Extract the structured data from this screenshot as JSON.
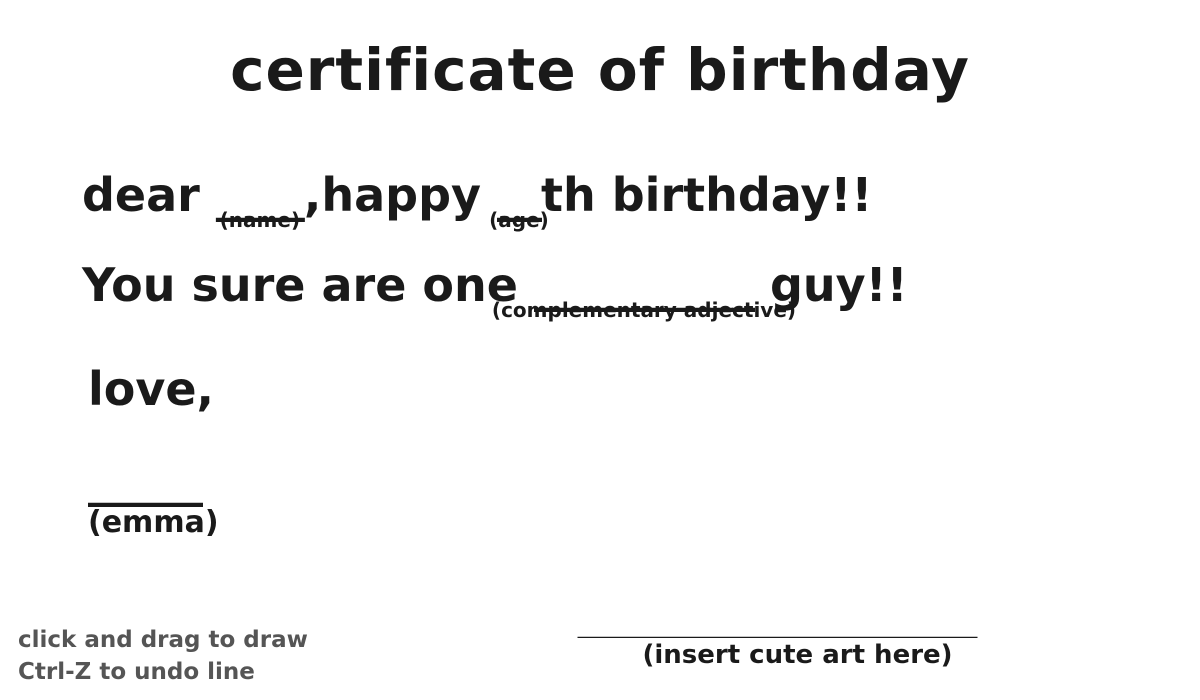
{
  "title": "certificate of birthday",
  "line1": {
    "dear": "dear",
    "name_blank": "____",
    "name_hint": "(name)",
    "comma_happy": ",happy",
    "age_blank": "__",
    "age_hint": "(age)",
    "th_birthday": "th birthday!!"
  },
  "line2": {
    "text": "You sure are one",
    "adj_blank": "__________",
    "adj_hint": "(complementary adjective)",
    "guy": "guy!!"
  },
  "line3": {
    "love": "love,"
  },
  "signature": {
    "blank": "_____",
    "hint": "(emma)"
  },
  "art": {
    "blank": "____________________",
    "hint": "(insert cute art here)"
  },
  "instructions": {
    "line1": "click and drag to draw",
    "line2": "Ctrl-Z to undo line"
  },
  "colors": {
    "ink": "#1a1a1a",
    "instructions": "#555555",
    "background": "#ffffff"
  }
}
